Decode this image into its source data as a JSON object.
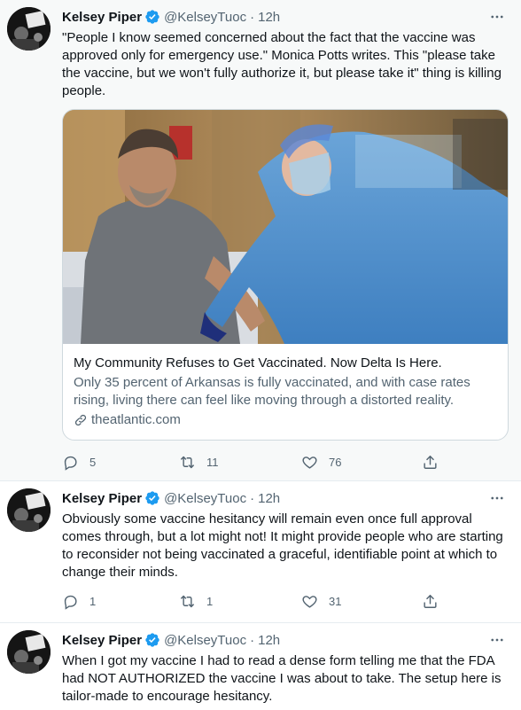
{
  "tweets": [
    {
      "author_name": "Kelsey Piper",
      "handle": "@KelseyTuoc",
      "time": "12h",
      "text": "\"People I know seemed concerned about the fact that the vaccine was approved only for emergency use.\" Monica Potts writes. This \"please take the vaccine, but we won't fully authorize it, but please take it\" thing is killing people.",
      "card": {
        "title": "My Community Refuses to Get Vaccinated. Now Delta Is Here.",
        "description": "Only 35 percent of Arkansas is fully vaccinated, and with case rates rising, living there can feel like moving through a distorted reality.",
        "domain": "theatlantic.com"
      },
      "replies": "5",
      "retweets": "11",
      "likes": "76"
    },
    {
      "author_name": "Kelsey Piper",
      "handle": "@KelseyTuoc",
      "time": "12h",
      "text": "Obviously some vaccine hesitancy will remain even once full approval comes through, but a lot might not! It might provide people who are starting to reconsider not being vaccinated a graceful, identifiable point at which to change their minds.",
      "replies": "1",
      "retweets": "1",
      "likes": "31"
    },
    {
      "author_name": "Kelsey Piper",
      "handle": "@KelseyTuoc",
      "time": "12h",
      "text": "When I got my vaccine I had to read a dense form telling me that the FDA had NOT AUTHORIZED the vaccine I was about to take. The setup here is tailor-made to encourage hesitancy."
    }
  ],
  "icons": {
    "verified": "verified-badge-icon",
    "more": "more-options-icon",
    "reply": "reply-icon",
    "retweet": "retweet-icon",
    "like": "heart-icon",
    "share": "share-icon",
    "link": "link-icon"
  },
  "colors": {
    "accent": "#1d9bf0",
    "secondary_text": "#536471",
    "highlighted_background": "#f7f9f9"
  }
}
